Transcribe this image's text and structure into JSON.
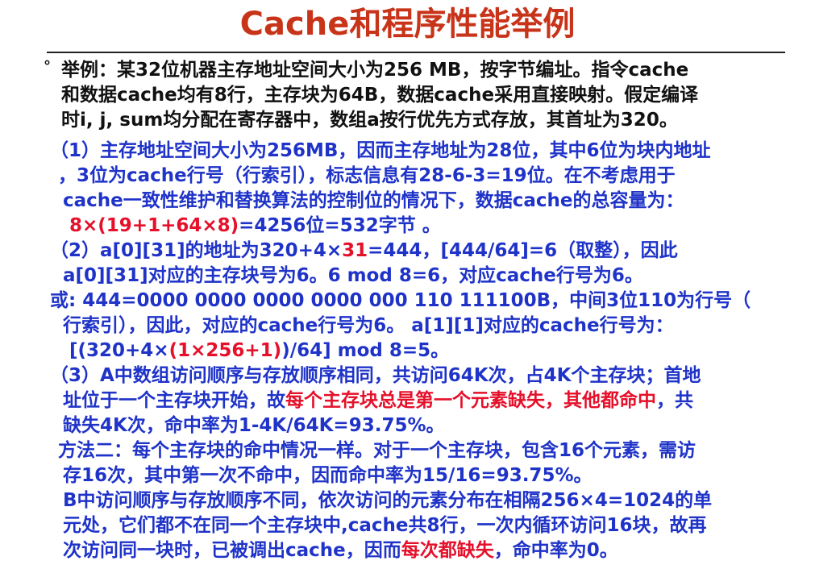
{
  "title": "Cache和程序性能举例",
  "bullet": "°",
  "lines": [
    {
      "s": [
        {
          "t": "举例：某32位机器主存地址空间大小为256 MB，按字节编址。指令cache",
          "c": "k"
        }
      ]
    },
    {
      "s": [
        {
          "t": "和数据cache均有8行，主存块为64B，数据cache采用直接映射。假定编译",
          "c": "k"
        }
      ]
    },
    {
      "s": [
        {
          "t": "时i, j, sum均分配在寄存器中，数组a按行优先方式存放，其首址为320。",
          "c": "k"
        }
      ]
    },
    {
      "s": [
        {
          "t": "（1）主存地址空间大小为256MB，因而主存地址为28位，其中6位为块内地址",
          "c": "b"
        }
      ]
    },
    {
      "s": [
        {
          "t": "，3位为cache行号（行索引），标志信息有28-6-3=19位。在不考虑用于",
          "c": "b"
        }
      ]
    },
    {
      "s": [
        {
          "t": "cache一致性维护和替换算法的控制位的情况下，数据cache的总容量为：",
          "c": "b"
        }
      ]
    },
    {
      "s": [
        {
          "t": "8×(19+1+64×8)",
          "c": "r"
        },
        {
          "t": "=4256位=532字节 。",
          "c": "b"
        }
      ]
    },
    {
      "s": [
        {
          "t": "（2）a[0][31]的地址为320+4×",
          "c": "b"
        },
        {
          "t": "31",
          "c": "r"
        },
        {
          "t": "=444，[444/64]=6（取整），因此",
          "c": "b"
        }
      ]
    },
    {
      "s": [
        {
          "t": "a[0][31]对应的主存块号为6。6 mod 8=6，对应cache行号为6。",
          "c": "b"
        }
      ]
    },
    {
      "s": [
        {
          "t": "或: 444=0000 0000 0000 0000 000 110 111100B，中间3位110为行号（",
          "c": "b"
        }
      ]
    },
    {
      "s": [
        {
          "t": "行索引），因此，对应的cache行号为6。 a[1][1]对应的cache行号为：",
          "c": "b"
        }
      ]
    },
    {
      "s": [
        {
          "t": "[(320+4×",
          "c": "b"
        },
        {
          "t": "(1×256+1)",
          "c": "r"
        },
        {
          "t": ")/64] mod 8=5。",
          "c": "b"
        }
      ]
    },
    {
      "s": [
        {
          "t": "（3）A中数组访问顺序与存放顺序相同，共访问64K次，占4K个主存块；首地",
          "c": "b"
        }
      ]
    },
    {
      "s": [
        {
          "t": "址位于一个主存块开始，故",
          "c": "b"
        },
        {
          "t": "每个主存块总是第一个元素缺失，其他都命中",
          "c": "r"
        },
        {
          "t": "，共",
          "c": "b"
        }
      ]
    },
    {
      "s": [
        {
          "t": "缺失4K次，命中率为1-4K/64K=93.75%。",
          "c": "b"
        }
      ]
    },
    {
      "s": [
        {
          "t": "方法二：每个主存块的命中情况一样。对于一个主存块，包含16个元素，需访",
          "c": "b"
        }
      ]
    },
    {
      "s": [
        {
          "t": "存16次，其中第一次不命中，因而命中率为15/16=93.75%。",
          "c": "b"
        }
      ]
    },
    {
      "s": [
        {
          "t": "B中访问顺序与存放顺序不同，依次访问的元素分布在相隔256×4=1024的单",
          "c": "b"
        }
      ]
    },
    {
      "s": [
        {
          "t": "元处，它们都不在同一个主存块中,cache共8行，一次内循环访问16块，故再",
          "c": "b"
        }
      ]
    },
    {
      "s": [
        {
          "t": "次访问同一块时，已被调出cache，因而",
          "c": "b"
        },
        {
          "t": "每次都缺失",
          "c": "r"
        },
        {
          "t": "，命中率为0。",
          "c": "b"
        }
      ]
    }
  ]
}
